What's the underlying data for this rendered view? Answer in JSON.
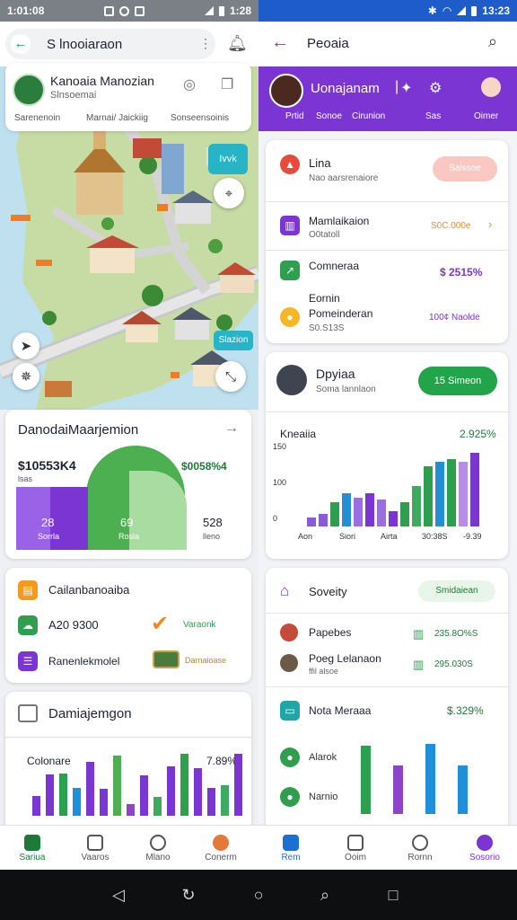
{
  "left": {
    "status": {
      "time": "1:01:08",
      "right_time": "1:28"
    },
    "search": {
      "value": "S lnooiaraon"
    },
    "profile": {
      "name": "Kanoaia Manozian",
      "subtitle": "Slnsoemai",
      "tabs": [
        "Sarenenoin",
        "Marnai/ Jaickiig",
        "Sonseensoinis"
      ]
    },
    "map": {
      "label_top": "Ivvk",
      "label_bottom": "Slazion"
    },
    "dash": {
      "title": "DanodaiMaarjemion",
      "stat_left": "$10553K4",
      "stat_left_sub": "lsas",
      "stat_right": "$0058%4",
      "blocks": [
        {
          "value": "28",
          "label": "Sorrla"
        },
        {
          "value": "69",
          "label": "Rosla"
        },
        {
          "value": "528",
          "label": "lleno"
        }
      ]
    },
    "list": {
      "title": "Cailanbanoaiba",
      "rows": [
        {
          "label": "A20 9300",
          "right": "Varaonk"
        },
        {
          "label": "Ranenlekmolel",
          "right": "Darnaioase"
        }
      ]
    },
    "chart": {
      "header": "Damiajemgon",
      "subtitle": "Colonare",
      "percent": "7.89%"
    },
    "nav": [
      {
        "label": "Sariua"
      },
      {
        "label": "Vaaros"
      },
      {
        "label": "Mlano"
      },
      {
        "label": "Conerm"
      }
    ],
    "colors": {
      "accent": "#1f9a4a"
    }
  },
  "right": {
    "status": {
      "time": "13:23"
    },
    "header": {
      "title": "Peoaia"
    },
    "banner": {
      "name": "Uonajanam",
      "tabs": [
        "Prtid",
        "Sonoe",
        "Cirunion",
        "Sas",
        "Oimer"
      ]
    },
    "items": [
      {
        "title": "Lina",
        "sub": "Nao aarsrenaiore",
        "action": "Salssoe"
      },
      {
        "title": "Mamlaikaion",
        "sub": "O0tatoll",
        "value": "S0C.000e"
      },
      {
        "title": "Comneraa",
        "value": "$ 2515%"
      },
      {
        "title": "Eornin Pomeinderan",
        "sub": "S0.S13S",
        "value": "100¢ Naolde"
      }
    ],
    "promo": {
      "title": "Dpyiaa",
      "sub": "Soma lannlaon",
      "button": "15 Simeon"
    },
    "chart1": {
      "title": "Kneaiia",
      "percent": "2.925%"
    },
    "society": {
      "title": "Soveity",
      "pill": "Smidaiean"
    },
    "rows": [
      {
        "name": "Papebes",
        "value": "235.8O%S"
      },
      {
        "name": "Poeg Lelanaon",
        "sub": "ffil alsoe",
        "value": "295.030S"
      }
    ],
    "nota": {
      "title": "Nota Meraaa",
      "value": "$.329%"
    },
    "legend": [
      "Alarok",
      "Narnio"
    ],
    "nav": [
      {
        "label": "Rem"
      },
      {
        "label": "Ooim"
      },
      {
        "label": "Rornn"
      },
      {
        "label": "Sosorio"
      }
    ],
    "colors": {
      "accent": "#7b35d2"
    }
  },
  "chart_data": [
    {
      "type": "bar",
      "title": "Kneaiia",
      "yticks": [
        "150",
        "100",
        "0"
      ],
      "xticks": [
        "Aon",
        "Siori",
        "Airta",
        "30:38S",
        "-9.39"
      ],
      "ylim": [
        0,
        160
      ],
      "values": [
        10,
        14,
        27,
        37,
        32,
        37,
        30,
        17,
        27,
        45,
        67,
        72,
        75,
        72,
        82
      ],
      "colors": [
        "#8a5ad8",
        "#8a5ad8",
        "#2f9e4f",
        "#1f8fd8",
        "#9a6ee0",
        "#7b35d2",
        "#9a6ee0",
        "#7b35d2",
        "#2f9e4f",
        "#3fa95f",
        "#2f9e4f",
        "#1f8fd8",
        "#2f9e4f",
        "#b88de8",
        "#7b35d2"
      ]
    },
    {
      "type": "bar",
      "title": "Damiajemgon",
      "values": [
        23,
        48,
        49,
        32,
        62,
        31,
        70,
        14,
        47,
        22,
        57,
        72,
        55,
        32,
        35,
        72
      ],
      "colors": [
        "#7b35d2",
        "#7b35d2",
        "#2f9e4f",
        "#1f8fd8",
        "#7b35d2",
        "#7b35d2",
        "#4caf50",
        "#8e44c8",
        "#7b35d2",
        "#3fa95f",
        "#7b35d2",
        "#2f9e4f",
        "#7b35d2",
        "#7b35d2",
        "#3fa95f",
        "#7b35d2"
      ]
    },
    {
      "type": "bar",
      "title": "Nota Meraaa",
      "values": [
        78,
        55,
        80,
        55
      ],
      "colors": [
        "#2f9e4f",
        "#8e44c8",
        "#1f8fd8",
        "#1f8fd8"
      ]
    }
  ]
}
